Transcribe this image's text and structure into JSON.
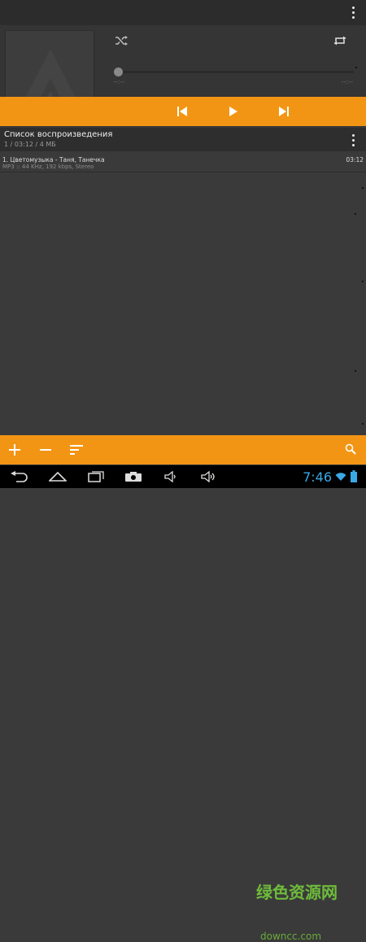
{
  "app": {
    "menu_icon": "kebab-menu-icon"
  },
  "player": {
    "shuffle_icon": "shuffle-icon",
    "repeat_icon": "repeat-icon",
    "time_elapsed": "--:--",
    "time_total": "--:--",
    "controls": {
      "previous_icon": "skip-previous-icon",
      "play_icon": "play-icon",
      "next_icon": "skip-next-icon"
    },
    "accent_color": "#f39514"
  },
  "playlist": {
    "title": "Список воспроизведения",
    "summary": "1 / 03:12 / 4 МБ",
    "items": [
      {
        "title": "1. Цветомузыка - Таня, Танечка",
        "details": "MP3 :: 44 KHz, 192 kbps, Stereo",
        "duration": "03:12"
      }
    ]
  },
  "toolbar": {
    "add_icon": "plus-icon",
    "remove_icon": "minus-icon",
    "sort_icon": "sort-icon",
    "search_icon": "search-icon"
  },
  "system_nav": {
    "clock": "7:46",
    "watermark": "绿色资源网",
    "watermark_sub": "downcc.com"
  }
}
